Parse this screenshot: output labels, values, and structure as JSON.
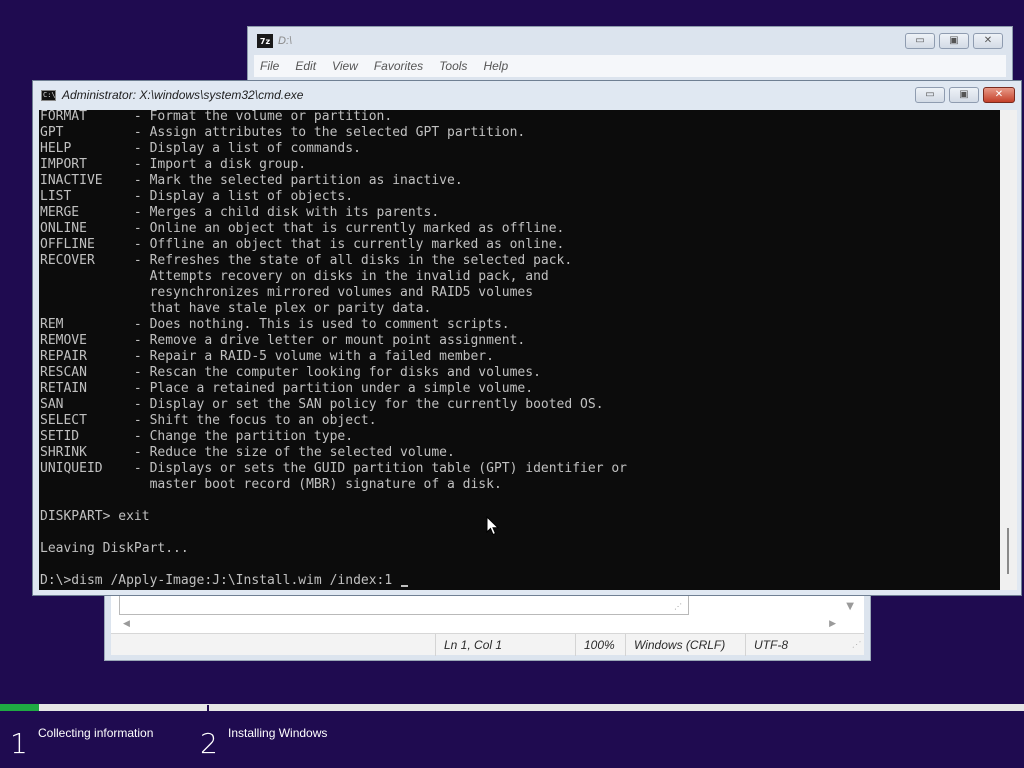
{
  "zip_window": {
    "title": "D:\\",
    "icon_label": "7z",
    "menu": [
      "File",
      "Edit",
      "View",
      "Favorites",
      "Tools",
      "Help"
    ],
    "buttons": {
      "minimize": "▭",
      "maximize": "▣",
      "close": "✕"
    }
  },
  "cmd_window": {
    "title": "Administrator: X:\\windows\\system32\\cmd.exe",
    "icon_label": "C:\\",
    "buttons": {
      "minimize": "▭",
      "maximize": "▣",
      "close": "✕"
    },
    "lines": [
      "FORMAT      - Format the volume or partition.",
      "GPT         - Assign attributes to the selected GPT partition.",
      "HELP        - Display a list of commands.",
      "IMPORT      - Import a disk group.",
      "INACTIVE    - Mark the selected partition as inactive.",
      "LIST        - Display a list of objects.",
      "MERGE       - Merges a child disk with its parents.",
      "ONLINE      - Online an object that is currently marked as offline.",
      "OFFLINE     - Offline an object that is currently marked as online.",
      "RECOVER     - Refreshes the state of all disks in the selected pack.",
      "              Attempts recovery on disks in the invalid pack, and",
      "              resynchronizes mirrored volumes and RAID5 volumes",
      "              that have stale plex or parity data.",
      "REM         - Does nothing. This is used to comment scripts.",
      "REMOVE      - Remove a drive letter or mount point assignment.",
      "REPAIR      - Repair a RAID-5 volume with a failed member.",
      "RESCAN      - Rescan the computer looking for disks and volumes.",
      "RETAIN      - Place a retained partition under a simple volume.",
      "SAN         - Display or set the SAN policy for the currently booted OS.",
      "SELECT      - Shift the focus to an object.",
      "SETID       - Change the partition type.",
      "SHRINK      - Reduce the size of the selected volume.",
      "UNIQUEID    - Displays or sets the GUID partition table (GPT) identifier or",
      "              master boot record (MBR) signature of a disk.",
      "",
      "DISKPART> exit",
      "",
      "Leaving DiskPart...",
      ""
    ],
    "prompt": "D:\\>dism /Apply-Image:J:\\Install.wim /index:1 "
  },
  "notepad_window": {
    "status": {
      "position": "Ln 1, Col 1",
      "zoom": "100%",
      "line_ending": "Windows (CRLF)",
      "encoding": "UTF-8"
    }
  },
  "setup": {
    "progress": 0.038,
    "steps": [
      {
        "number": "1",
        "label": "Collecting information"
      },
      {
        "number": "2",
        "label": "Installing Windows"
      }
    ]
  },
  "colors": {
    "desktop": "#1f0b50",
    "progress_fill": "#1fa943",
    "console_bg": "#0c0c0c",
    "console_text": "#c0c0c0"
  }
}
